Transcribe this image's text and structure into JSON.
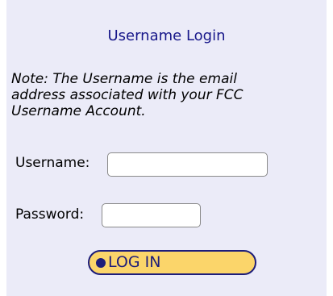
{
  "login": {
    "title": "Username Login",
    "note": "Note: The Username is the email address associated with your FCC Username Account.",
    "username_label": "Username:",
    "username_value": "",
    "password_label": "Password:",
    "password_value": "",
    "login_button_label": "LOG IN"
  },
  "colors": {
    "panel_background": "#ebebf8",
    "title_text": "#17178a",
    "button_fill": "#fbd56a",
    "button_border": "#1d1d7a"
  },
  "icons": {
    "button_bullet": "bullet-icon"
  }
}
